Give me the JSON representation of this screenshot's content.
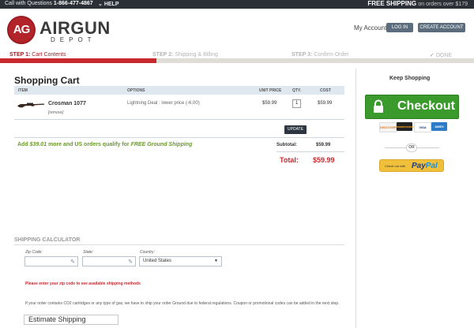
{
  "topbar": {
    "call_prefix": "Call with Questions",
    "phone": "1-866-477-4867",
    "help": "HELP",
    "free_bold": "FREE SHIPPING",
    "free_rest": "on orders over $179"
  },
  "logo": {
    "mark": "AG",
    "name": "AIRGUN",
    "sub": "DEPOT"
  },
  "header": {
    "account": "My Account",
    "login": "LOG IN",
    "create": "CREATE ACCOUNT"
  },
  "steps": [
    {
      "num": "STEP 1:",
      "label": "Cart Contents"
    },
    {
      "num": "STEP 2:",
      "label": "Shipping & Billing"
    },
    {
      "num": "STEP 3:",
      "label": "Confirm Order"
    },
    {
      "num": "✓",
      "label": "DONE"
    }
  ],
  "progress_fraction": 0.33,
  "cart": {
    "title": "Shopping Cart",
    "columns": [
      "ITEM",
      "OPTIONS",
      "UNIT PRICE",
      "QTY.",
      "COST"
    ],
    "item": {
      "name": "Crosman 1077",
      "remove": "[remove]",
      "options": "Lightning Deal : lower price (-6.00)",
      "unit_price": "$59.99",
      "qty": "1",
      "cost": "$59.99"
    },
    "update": "UPDATE",
    "promo_prefix": "Add",
    "promo_amount": "$39.01",
    "promo_mid": "more and US orders qualify for",
    "promo_bold": "FREE Ground Shipping",
    "subtotal_label": "Subtotal:",
    "subtotal_value": "$59.99",
    "total_label": "Total:",
    "total_value": "$59.99"
  },
  "sidebar": {
    "keep_shopping": "Keep Shopping",
    "checkout": "Checkout",
    "cards": [
      "DISCOVER",
      "mastercard",
      "VISA",
      "AMEX"
    ],
    "or": "OR",
    "paypal_small": "Check out with",
    "paypal_pay": "Pay",
    "paypal_pal": "Pal"
  },
  "shipping": {
    "title": "SHIPPING CALCULATOR",
    "zip_label": "Zip Code:",
    "state_label": "State:",
    "country_label": "Country:",
    "country_value": "United States",
    "warning": "Please enter your zip code to see available shipping methods",
    "note": "If your order contains CO2 cartridges or any type of gas, we have to ship your order Ground due to federal regulations. Coupon or promotional codes can be added in the next step.",
    "estimate": "Estimate Shipping"
  },
  "colors": {
    "brand_red": "#c8282e",
    "checkout_green": "#3a9a2c",
    "promo_green": "#6a9a2a",
    "topbar": "#2b2f36"
  }
}
